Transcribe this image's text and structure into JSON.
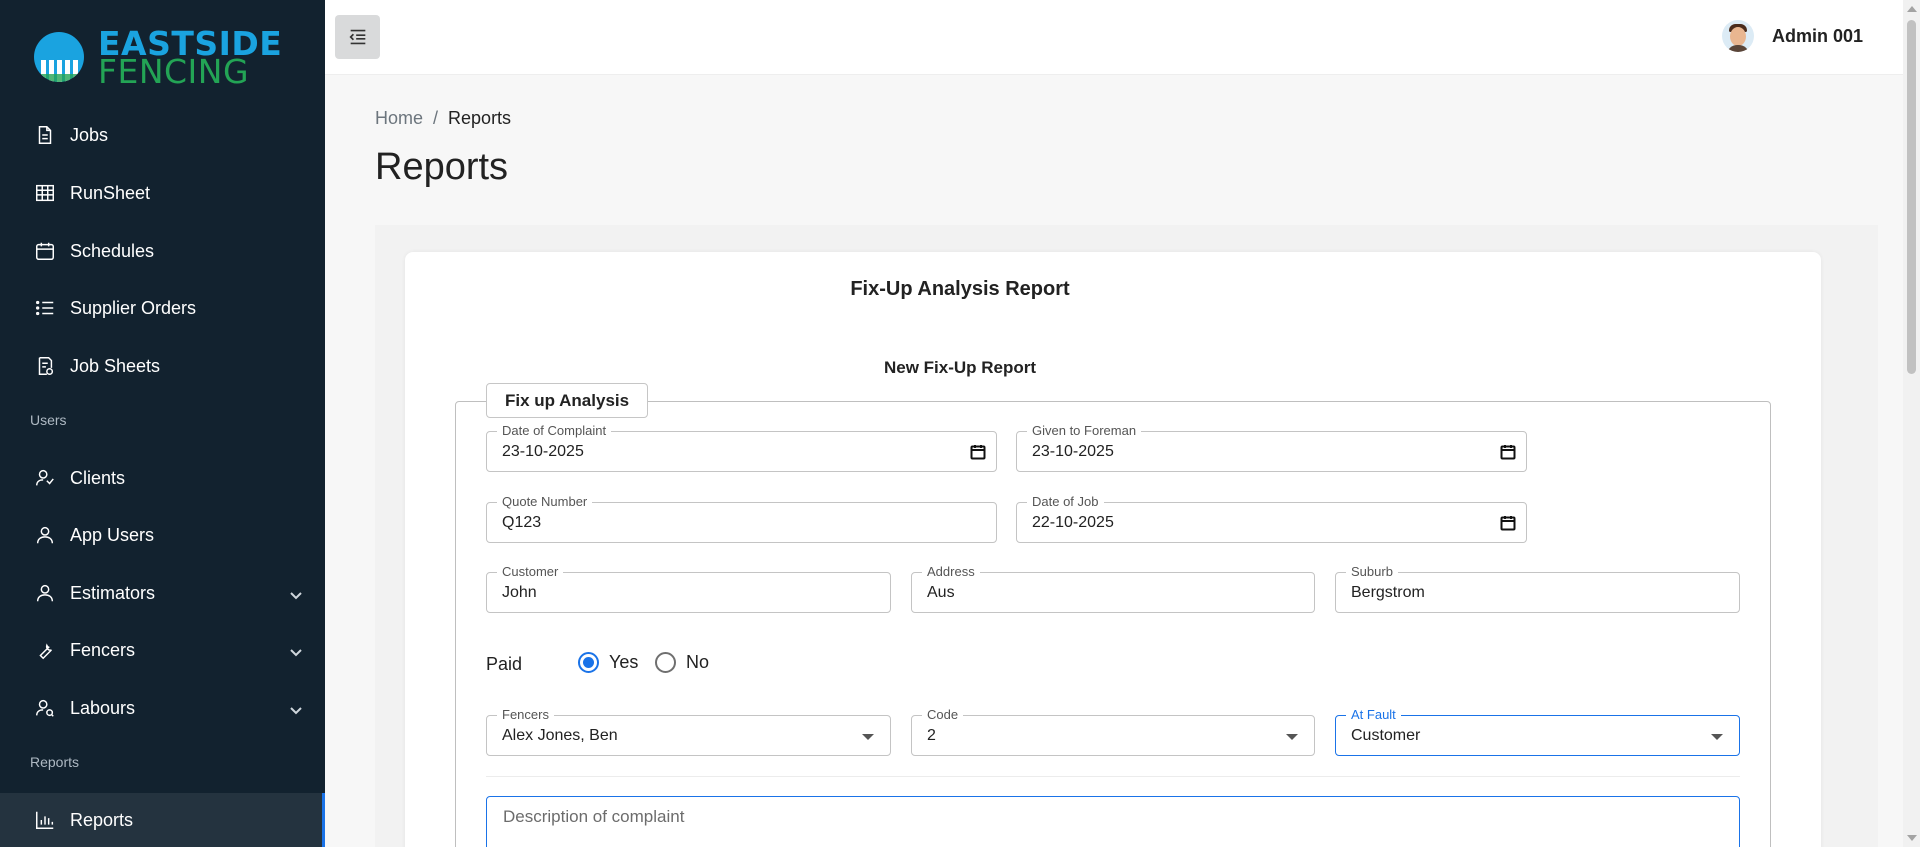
{
  "brand": {
    "line1": "EASTSIDE",
    "line2": "FENCING"
  },
  "sidebar": {
    "items": [
      {
        "label": "Jobs",
        "icon": "document-icon"
      },
      {
        "label": "RunSheet",
        "icon": "table-icon"
      },
      {
        "label": "Schedules",
        "icon": "calendar-icon"
      },
      {
        "label": "Supplier Orders",
        "icon": "list-icon"
      },
      {
        "label": "Job Sheets",
        "icon": "job-sheet-icon"
      }
    ],
    "users_section": "Users",
    "user_items": [
      {
        "label": "Clients",
        "icon": "clients-icon"
      },
      {
        "label": "App Users",
        "icon": "user-icon"
      },
      {
        "label": "Estimators",
        "icon": "user-icon"
      },
      {
        "label": "Fencers",
        "icon": "wrench-icon"
      },
      {
        "label": "Labours",
        "icon": "labour-icon"
      }
    ],
    "reports_section": "Reports",
    "report_items": [
      {
        "label": "Reports",
        "icon": "bar-chart-icon",
        "active": true
      }
    ]
  },
  "header": {
    "user_name": "Admin 001"
  },
  "breadcrumb": {
    "home": "Home",
    "separator": "/",
    "current": "Reports"
  },
  "page": {
    "title": "Reports"
  },
  "card": {
    "title": "Fix-Up Analysis Report",
    "subtitle": "New Fix-Up Report",
    "legend": "Fix up Analysis"
  },
  "form": {
    "date_of_complaint": {
      "label": "Date of Complaint",
      "value": "23-10-2025"
    },
    "given_to_foreman": {
      "label": "Given to Foreman",
      "value": "23-10-2025"
    },
    "quote_number": {
      "label": "Quote Number",
      "value": "Q123"
    },
    "date_of_job": {
      "label": "Date of Job",
      "value": "22-10-2025"
    },
    "customer": {
      "label": "Customer",
      "value": "John"
    },
    "address": {
      "label": "Address",
      "value": "Aus"
    },
    "suburb": {
      "label": "Suburb",
      "value": "Bergstrom"
    },
    "paid": {
      "label": "Paid",
      "yes": "Yes",
      "no": "No",
      "selected": "Yes"
    },
    "fencers": {
      "label": "Fencers",
      "value": "Alex Jones, Ben"
    },
    "code": {
      "label": "Code",
      "value": "2"
    },
    "at_fault": {
      "label": "At Fault",
      "value": "Customer"
    },
    "description": {
      "placeholder": "Description of complaint"
    }
  },
  "colors": {
    "sidebar_bg": "#12222f",
    "accent": "#1a73e8",
    "brand_blue": "#1aa3e0",
    "brand_green": "#23a455"
  }
}
